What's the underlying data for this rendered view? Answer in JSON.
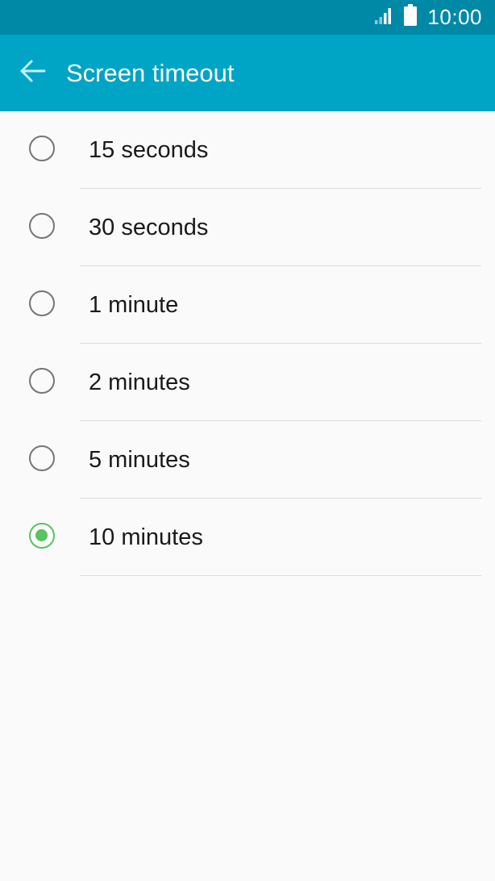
{
  "status_bar": {
    "time": "10:00",
    "icons": [
      "signal-icon",
      "battery-icon"
    ]
  },
  "header": {
    "title": "Screen timeout",
    "back_icon": "arrow-left-icon"
  },
  "options": [
    {
      "label": "15 seconds",
      "selected": false
    },
    {
      "label": "30 seconds",
      "selected": false
    },
    {
      "label": "1 minute",
      "selected": false
    },
    {
      "label": "2 minutes",
      "selected": false
    },
    {
      "label": "5 minutes",
      "selected": false
    },
    {
      "label": "10 minutes",
      "selected": true
    }
  ],
  "colors": {
    "status_bar": "#0089a6",
    "app_bar": "#00a4c5",
    "accent": "#5cc160",
    "back_arrow": "#bff3ff"
  }
}
